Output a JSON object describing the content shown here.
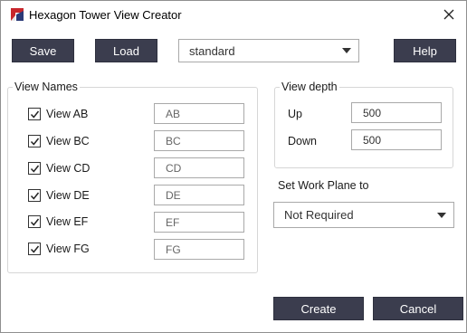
{
  "window": {
    "title": "Hexagon Tower View Creator",
    "accent_color": "#3b3d4e"
  },
  "toolbar": {
    "save_label": "Save",
    "load_label": "Load",
    "preset_selected": "standard",
    "help_label": "Help"
  },
  "view_names": {
    "group_label": "View Names",
    "items": [
      {
        "label": "View AB",
        "checked": true,
        "value": "AB"
      },
      {
        "label": "View BC",
        "checked": true,
        "value": "BC"
      },
      {
        "label": "View CD",
        "checked": true,
        "value": "CD"
      },
      {
        "label": "View DE",
        "checked": true,
        "value": "DE"
      },
      {
        "label": "View EF",
        "checked": true,
        "value": "EF"
      },
      {
        "label": "View FG",
        "checked": true,
        "value": "FG"
      }
    ]
  },
  "view_depth": {
    "group_label": "View depth",
    "up_label": "Up",
    "up_value": "500",
    "down_label": "Down",
    "down_value": "500"
  },
  "work_plane": {
    "label": "Set Work Plane to",
    "selected": "Not Required"
  },
  "footer": {
    "create_label": "Create",
    "cancel_label": "Cancel"
  }
}
